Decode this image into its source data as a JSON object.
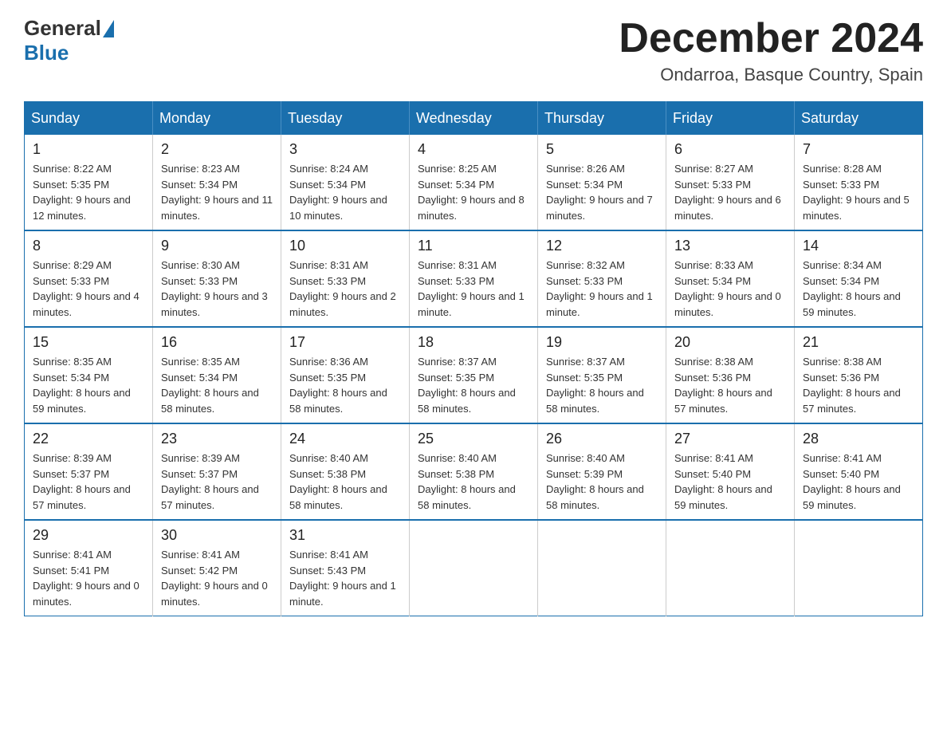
{
  "logo": {
    "general": "General",
    "blue": "Blue"
  },
  "header": {
    "month": "December 2024",
    "location": "Ondarroa, Basque Country, Spain"
  },
  "days_of_week": [
    "Sunday",
    "Monday",
    "Tuesday",
    "Wednesday",
    "Thursday",
    "Friday",
    "Saturday"
  ],
  "weeks": [
    [
      {
        "day": "1",
        "sunrise": "8:22 AM",
        "sunset": "5:35 PM",
        "daylight": "9 hours and 12 minutes."
      },
      {
        "day": "2",
        "sunrise": "8:23 AM",
        "sunset": "5:34 PM",
        "daylight": "9 hours and 11 minutes."
      },
      {
        "day": "3",
        "sunrise": "8:24 AM",
        "sunset": "5:34 PM",
        "daylight": "9 hours and 10 minutes."
      },
      {
        "day": "4",
        "sunrise": "8:25 AM",
        "sunset": "5:34 PM",
        "daylight": "9 hours and 8 minutes."
      },
      {
        "day": "5",
        "sunrise": "8:26 AM",
        "sunset": "5:34 PM",
        "daylight": "9 hours and 7 minutes."
      },
      {
        "day": "6",
        "sunrise": "8:27 AM",
        "sunset": "5:33 PM",
        "daylight": "9 hours and 6 minutes."
      },
      {
        "day": "7",
        "sunrise": "8:28 AM",
        "sunset": "5:33 PM",
        "daylight": "9 hours and 5 minutes."
      }
    ],
    [
      {
        "day": "8",
        "sunrise": "8:29 AM",
        "sunset": "5:33 PM",
        "daylight": "9 hours and 4 minutes."
      },
      {
        "day": "9",
        "sunrise": "8:30 AM",
        "sunset": "5:33 PM",
        "daylight": "9 hours and 3 minutes."
      },
      {
        "day": "10",
        "sunrise": "8:31 AM",
        "sunset": "5:33 PM",
        "daylight": "9 hours and 2 minutes."
      },
      {
        "day": "11",
        "sunrise": "8:31 AM",
        "sunset": "5:33 PM",
        "daylight": "9 hours and 1 minute."
      },
      {
        "day": "12",
        "sunrise": "8:32 AM",
        "sunset": "5:33 PM",
        "daylight": "9 hours and 1 minute."
      },
      {
        "day": "13",
        "sunrise": "8:33 AM",
        "sunset": "5:34 PM",
        "daylight": "9 hours and 0 minutes."
      },
      {
        "day": "14",
        "sunrise": "8:34 AM",
        "sunset": "5:34 PM",
        "daylight": "8 hours and 59 minutes."
      }
    ],
    [
      {
        "day": "15",
        "sunrise": "8:35 AM",
        "sunset": "5:34 PM",
        "daylight": "8 hours and 59 minutes."
      },
      {
        "day": "16",
        "sunrise": "8:35 AM",
        "sunset": "5:34 PM",
        "daylight": "8 hours and 58 minutes."
      },
      {
        "day": "17",
        "sunrise": "8:36 AM",
        "sunset": "5:35 PM",
        "daylight": "8 hours and 58 minutes."
      },
      {
        "day": "18",
        "sunrise": "8:37 AM",
        "sunset": "5:35 PM",
        "daylight": "8 hours and 58 minutes."
      },
      {
        "day": "19",
        "sunrise": "8:37 AM",
        "sunset": "5:35 PM",
        "daylight": "8 hours and 58 minutes."
      },
      {
        "day": "20",
        "sunrise": "8:38 AM",
        "sunset": "5:36 PM",
        "daylight": "8 hours and 57 minutes."
      },
      {
        "day": "21",
        "sunrise": "8:38 AM",
        "sunset": "5:36 PM",
        "daylight": "8 hours and 57 minutes."
      }
    ],
    [
      {
        "day": "22",
        "sunrise": "8:39 AM",
        "sunset": "5:37 PM",
        "daylight": "8 hours and 57 minutes."
      },
      {
        "day": "23",
        "sunrise": "8:39 AM",
        "sunset": "5:37 PM",
        "daylight": "8 hours and 57 minutes."
      },
      {
        "day": "24",
        "sunrise": "8:40 AM",
        "sunset": "5:38 PM",
        "daylight": "8 hours and 58 minutes."
      },
      {
        "day": "25",
        "sunrise": "8:40 AM",
        "sunset": "5:38 PM",
        "daylight": "8 hours and 58 minutes."
      },
      {
        "day": "26",
        "sunrise": "8:40 AM",
        "sunset": "5:39 PM",
        "daylight": "8 hours and 58 minutes."
      },
      {
        "day": "27",
        "sunrise": "8:41 AM",
        "sunset": "5:40 PM",
        "daylight": "8 hours and 59 minutes."
      },
      {
        "day": "28",
        "sunrise": "8:41 AM",
        "sunset": "5:40 PM",
        "daylight": "8 hours and 59 minutes."
      }
    ],
    [
      {
        "day": "29",
        "sunrise": "8:41 AM",
        "sunset": "5:41 PM",
        "daylight": "9 hours and 0 minutes."
      },
      {
        "day": "30",
        "sunrise": "8:41 AM",
        "sunset": "5:42 PM",
        "daylight": "9 hours and 0 minutes."
      },
      {
        "day": "31",
        "sunrise": "8:41 AM",
        "sunset": "5:43 PM",
        "daylight": "9 hours and 1 minute."
      },
      null,
      null,
      null,
      null
    ]
  ]
}
